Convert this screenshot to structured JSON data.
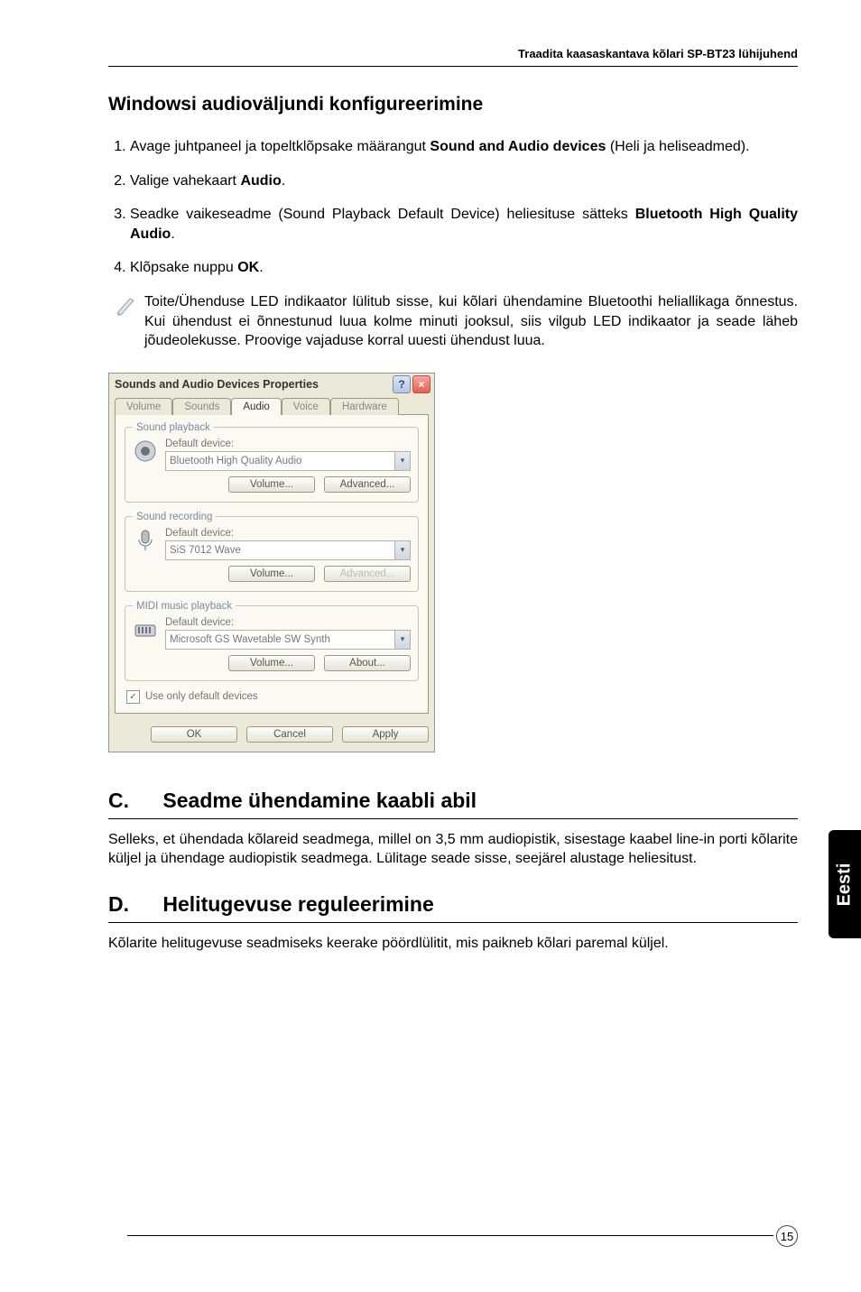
{
  "header": {
    "running": "Traadita kaasaskantava kõlari SP-BT23 lühijuhend"
  },
  "section_a": {
    "title": "Windowsi audioväljundi konfigureerimine",
    "steps": [
      {
        "pre": "Avage juhtpaneel ja topeltklõpsake määrangut ",
        "bold": "Sound and Audio devices",
        "post": " (Heli ja heliseadmed)."
      },
      {
        "pre": "Valige vahekaart ",
        "bold": "Audio",
        "post": "."
      },
      {
        "pre": "Seadke vaikeseadme (Sound Playback Default Device) heliesituse sätteks ",
        "bold": "Bluetooth High Quality Audio",
        "post": "."
      },
      {
        "pre": "Klõpsake nuppu ",
        "bold": "OK",
        "post": "."
      }
    ],
    "note": "Toite/Ühenduse LED indikaator lülitub sisse, kui kõlari ühendamine Bluetoothi heliallikaga õnnestus. Kui ühendust ei õnnestunud luua kolme minuti jooksul, siis vilgub LED indikaator ja seade läheb jõudeolekusse. Proovige vajaduse korral uuesti ühendust luua."
  },
  "dialog": {
    "title": "Sounds and Audio Devices Properties",
    "help": "?",
    "close": "×",
    "tabs": {
      "volume": "Volume",
      "sounds": "Sounds",
      "audio": "Audio",
      "voice": "Voice",
      "hardware": "Hardware"
    },
    "groups": {
      "playback": {
        "legend": "Sound playback",
        "label": "Default device:",
        "value": "Bluetooth High Quality Audio",
        "btn_volume": "Volume...",
        "btn_adv": "Advanced..."
      },
      "recording": {
        "legend": "Sound recording",
        "label": "Default device:",
        "value": "SiS 7012 Wave",
        "btn_volume": "Volume...",
        "btn_adv": "Advanced..."
      },
      "midi": {
        "legend": "MIDI music playback",
        "label": "Default device:",
        "value": "Microsoft GS Wavetable SW Synth",
        "btn_volume": "Volume...",
        "btn_about": "About..."
      }
    },
    "use_default": "Use only default devices",
    "buttons": {
      "ok": "OK",
      "cancel": "Cancel",
      "apply": "Apply"
    }
  },
  "section_c": {
    "letter": "C.",
    "title": "Seadme ühendamine kaabli abil",
    "body": "Selleks, et ühendada kõlareid seadmega, millel on 3,5 mm audiopistik, sisestage kaabel line-in porti kõlarite küljel ja ühendage audiopistik seadmega. Lülitage seade sisse, seejärel alustage heliesitust."
  },
  "section_d": {
    "letter": "D.",
    "title": "Helitugevuse reguleerimine",
    "body": "Kõlarite helitugevuse seadmiseks keerake pöördlülitit, mis paikneb kõlari paremal küljel."
  },
  "side_tab": "Eesti",
  "page_number": "15"
}
